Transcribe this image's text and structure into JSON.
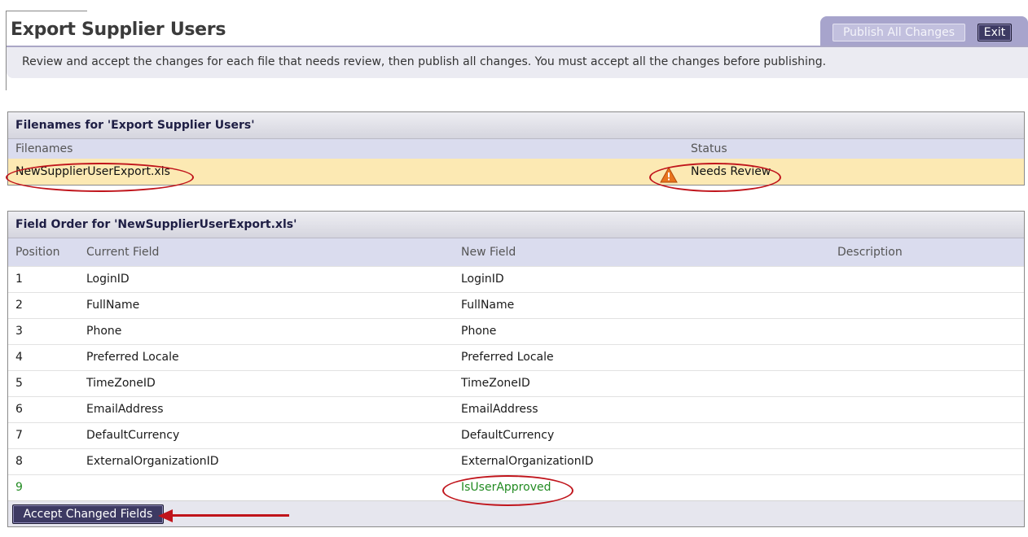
{
  "page": {
    "title": "Export Supplier Users",
    "instructions": "Review and accept the changes for each file that needs review, then publish all changes. You must accept all the changes before publishing."
  },
  "toolbar": {
    "publish_label": "Publish All Changes",
    "exit_label": "Exit"
  },
  "filenames_panel": {
    "header": "Filenames for 'Export Supplier Users'",
    "columns": {
      "filenames": "Filenames",
      "status": "Status"
    },
    "rows": [
      {
        "filename": "NewSupplierUserExport.xls",
        "status": "Needs Review",
        "status_icon": "warning-icon"
      }
    ]
  },
  "field_order_panel": {
    "header": "Field Order for 'NewSupplierUserExport.xls'",
    "columns": {
      "position": "Position",
      "current_field": "Current Field",
      "new_field": "New Field",
      "description": "Description"
    },
    "rows": [
      {
        "position": "1",
        "current": "LoginID",
        "new": "LoginID",
        "description": ""
      },
      {
        "position": "2",
        "current": "FullName",
        "new": "FullName",
        "description": ""
      },
      {
        "position": "3",
        "current": "Phone",
        "new": "Phone",
        "description": ""
      },
      {
        "position": "4",
        "current": "Preferred Locale",
        "new": "Preferred Locale",
        "description": ""
      },
      {
        "position": "5",
        "current": "TimeZoneID",
        "new": "TimeZoneID",
        "description": ""
      },
      {
        "position": "6",
        "current": "EmailAddress",
        "new": "EmailAddress",
        "description": ""
      },
      {
        "position": "7",
        "current": "DefaultCurrency",
        "new": "DefaultCurrency",
        "description": ""
      },
      {
        "position": "8",
        "current": "ExternalOrganizationID",
        "new": "ExternalOrganizationID",
        "description": ""
      },
      {
        "position": "9",
        "current": "",
        "new": "IsUserApproved",
        "description": "",
        "changed": true
      }
    ],
    "accept_label": "Accept Changed Fields"
  },
  "colors": {
    "accent": "#3d3a63",
    "toolbar": "#a7a4cc",
    "highlight_row": "#fce9b3",
    "changed_text": "#228b22",
    "annotation": "#c0141b"
  }
}
